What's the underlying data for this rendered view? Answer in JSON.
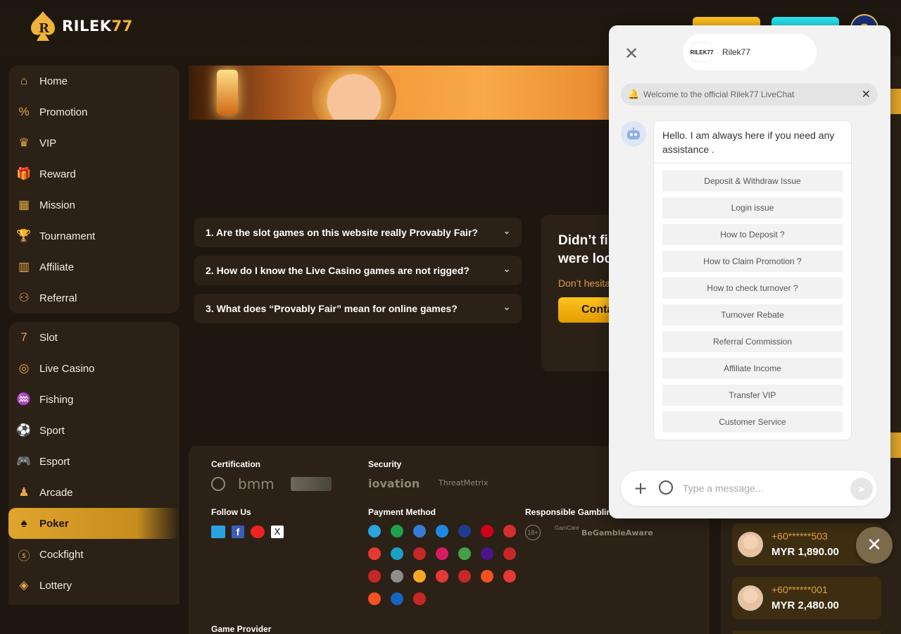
{
  "header": {
    "logo_text": "RILEK",
    "logo_num": "77"
  },
  "sidebar": {
    "group1": [
      {
        "label": "Home",
        "icon": "home-icon",
        "glyph": "⌂"
      },
      {
        "label": "Promotion",
        "icon": "percent-icon",
        "glyph": "%"
      },
      {
        "label": "VIP",
        "icon": "crown-icon",
        "glyph": "♛"
      },
      {
        "label": "Reward",
        "icon": "gift-icon",
        "glyph": "🎁"
      },
      {
        "label": "Mission",
        "icon": "calendar-icon",
        "glyph": "▦"
      },
      {
        "label": "Tournament",
        "icon": "trophy-icon",
        "glyph": "🏆"
      },
      {
        "label": "Affiliate",
        "icon": "building-icon",
        "glyph": "▥"
      },
      {
        "label": "Referral",
        "icon": "people-icon",
        "glyph": "⚇"
      }
    ],
    "group2": [
      {
        "label": "Slot",
        "icon": "slot-icon",
        "glyph": "7"
      },
      {
        "label": "Live Casino",
        "icon": "chip-icon",
        "glyph": "◎"
      },
      {
        "label": "Fishing",
        "icon": "fish-icon",
        "glyph": "♒"
      },
      {
        "label": "Sport",
        "icon": "ball-icon",
        "glyph": "⚽"
      },
      {
        "label": "Esport",
        "icon": "gamepad-icon",
        "glyph": "🎮"
      },
      {
        "label": "Arcade",
        "icon": "joystick-icon",
        "glyph": "♟"
      },
      {
        "label": "Poker",
        "icon": "cards-icon",
        "glyph": "♠"
      },
      {
        "label": "Cockfight",
        "icon": "rooster-icon",
        "glyph": "ⓢ"
      },
      {
        "label": "Lottery",
        "icon": "lottery-icon",
        "glyph": "◈"
      }
    ],
    "active": "Poker"
  },
  "faq": [
    "1. Are the slot games on this website really Provably Fair?",
    "2. How do I know the Live Casino games are not rigged?",
    "3. What does “Provably Fair” mean for online games?"
  ],
  "contact": {
    "heading": "Didn’t find what you were looking for?",
    "text": "Don’t hesitate to contact us! we will",
    "button": "Contact"
  },
  "footer": {
    "certification": "Certification",
    "security": "Security",
    "follow_us": "Follow Us",
    "payment_method": "Payment Method",
    "responsible": "Responsible Gambling",
    "game_provider": "Game Provider",
    "cert_bmm": "bmm",
    "sec_iovation": "iovation",
    "sec_threatmetrix": "ThreatMetrix",
    "resp_18": "18+",
    "resp_gamcare": "GamCare",
    "resp_begamble": "BeGambleAware"
  },
  "winners": [
    {
      "phone": "+60******503",
      "amount": "MYR  1,890.00"
    },
    {
      "phone": "+60******001",
      "amount": "MYR  2,480.00"
    }
  ],
  "chat": {
    "agent_name": "Rilek77",
    "agent_logo": "RILEK77",
    "welcome": "Welcome to the official Rilek77 LiveChat",
    "greeting": "Hello. I am always here if you need any assistance .",
    "options": [
      "Deposit & Withdraw Issue",
      "Login issue",
      "How to Deposit ?",
      "How to Claim Promotion ?",
      "How to check turnover ?",
      "Turnover Rebate",
      "Referral Commission",
      "Affiliate Income",
      "Transfer VIP",
      "Customer Service"
    ],
    "input_placeholder": "Type a message..."
  },
  "colors": {
    "accent_gold": "#e0a52c",
    "panel": "#2b2116",
    "background": "#1e170f"
  }
}
